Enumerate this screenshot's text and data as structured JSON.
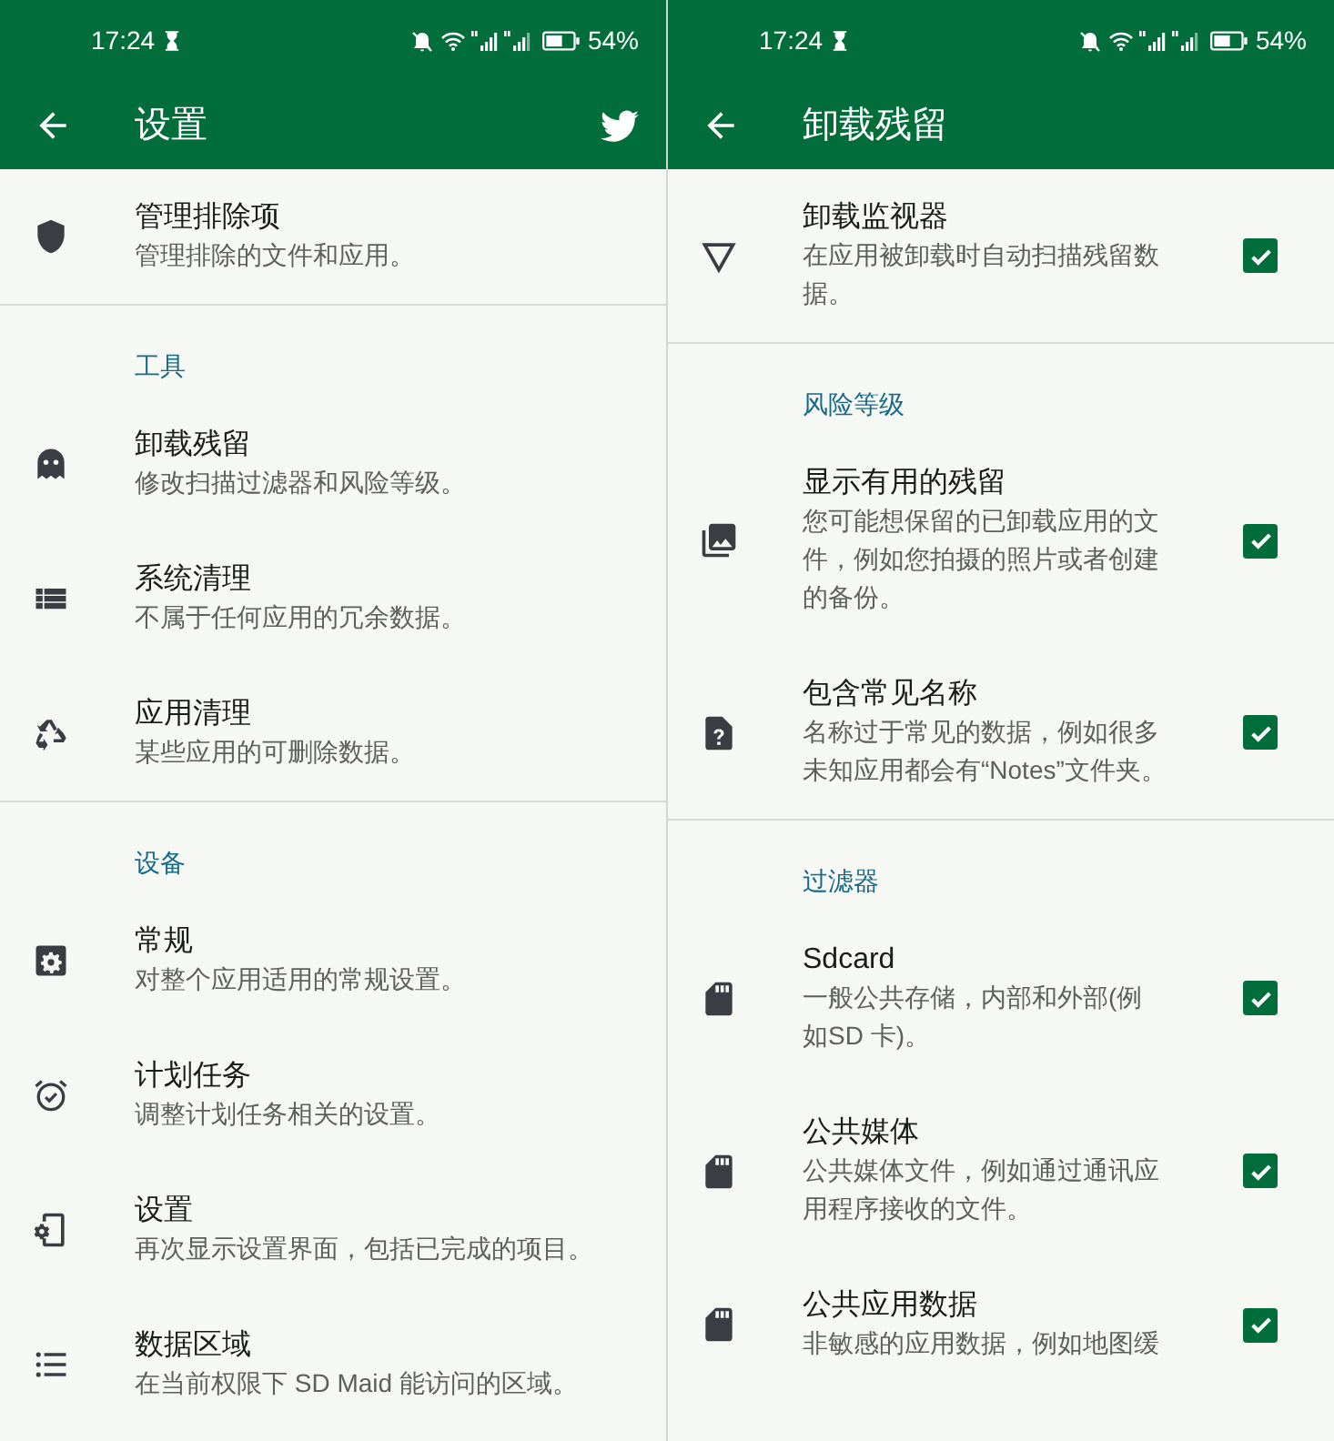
{
  "panels": [
    {
      "status_bar": {
        "time": "17:24",
        "battery": "54%"
      },
      "toolbar": {
        "title": "设置",
        "social_button": true
      },
      "groups": [
        {
          "items": [
            {
              "kind": "link",
              "title": "管理排除项",
              "subtitle": "管理排除的文件和应用。"
            }
          ]
        },
        {
          "header": "工具",
          "items": [
            {
              "kind": "link",
              "title": "卸载残留",
              "subtitle": "修改扫描过滤器和风险等级。"
            },
            {
              "kind": "link",
              "title": "系统清理",
              "subtitle": "不属于任何应用的冗余数据。"
            },
            {
              "kind": "link",
              "title": "应用清理",
              "subtitle": "某些应用的可删除数据。"
            }
          ]
        },
        {
          "header": "设备",
          "items": [
            {
              "kind": "link",
              "title": "常规",
              "subtitle": "对整个应用适用的常规设置。"
            },
            {
              "kind": "link",
              "title": "计划任务",
              "subtitle": "调整计划任务相关的设置。"
            },
            {
              "kind": "link",
              "title": "设置",
              "subtitle": "再次显示设置界面，包括已完成的项目。"
            },
            {
              "kind": "link",
              "title": "数据区域",
              "subtitle": "在当前权限下 SD Maid 能访问的区域。"
            }
          ]
        }
      ]
    },
    {
      "status_bar": {
        "time": "17:24",
        "battery": "54%"
      },
      "toolbar": {
        "title": "卸载残留",
        "social_button": false
      },
      "groups": [
        {
          "items": [
            {
              "kind": "checkbox",
              "title": "卸载监视器",
              "subtitle": "在应用被卸载时自动扫描残留数据。",
              "checked": true
            }
          ]
        },
        {
          "header": "风险等级",
          "items": [
            {
              "kind": "checkbox",
              "title": "显示有用的残留",
              "subtitle": "您可能想保留的已卸载应用的文件，例如您拍摄的照片或者创建的备份。",
              "checked": true
            },
            {
              "kind": "checkbox",
              "title": "包含常见名称",
              "subtitle": "名称过于常见的数据，例如很多未知应用都会有“Notes”文件夹。",
              "checked": true
            }
          ]
        },
        {
          "header": "过滤器",
          "items": [
            {
              "kind": "checkbox",
              "title": "Sdcard",
              "subtitle": "一般公共存储，内部和外部(例如SD 卡)。",
              "checked": true
            },
            {
              "kind": "checkbox",
              "title": "公共媒体",
              "subtitle": "公共媒体文件，例如通过通讯应用程序接收的文件。",
              "checked": true
            },
            {
              "kind": "checkbox",
              "title": "公共应用数据",
              "subtitle": "非敏感的应用数据，例如地图缓",
              "checked": true
            }
          ]
        }
      ]
    }
  ]
}
